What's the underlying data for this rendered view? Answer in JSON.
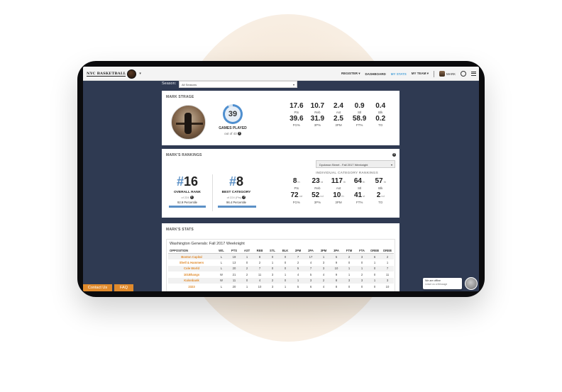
{
  "navbar": {
    "logo_text": "NYC BASKETBALL",
    "caret": "▾",
    "links": [
      {
        "label": "REGISTER ▾",
        "active": false
      },
      {
        "label": "DASHBOARD",
        "active": false
      },
      {
        "label": "MY STATS",
        "active": true
      },
      {
        "label": "MY TEAM ▾",
        "active": false
      }
    ],
    "user_name": "MARK",
    "icons": [
      "user-avatar-icon",
      "power-icon",
      "menu-icon"
    ]
  },
  "season": {
    "label": "Season:",
    "selected": "All Seasons",
    "caret": "▾"
  },
  "profile": {
    "title": "MARK STRAGE",
    "games_played": "39",
    "games_label": "GAMES PLAYED",
    "games_out_of": "out of 43",
    "stats": [
      {
        "value": "17.6",
        "label": "Pts"
      },
      {
        "value": "10.7",
        "label": "Reb"
      },
      {
        "value": "2.4",
        "label": "Ast"
      },
      {
        "value": "0.9",
        "label": "Stl"
      },
      {
        "value": "0.4",
        "label": "Blk"
      },
      {
        "value": "39.6",
        "label": "FG%"
      },
      {
        "value": "31.9",
        "label": "3P%"
      },
      {
        "value": "2.5",
        "label": "3PM"
      },
      {
        "value": "58.9",
        "label": "FT%"
      },
      {
        "value": "0.2",
        "label": "TO"
      }
    ]
  },
  "rankings": {
    "title": "MARK'S RANKINGS",
    "league_select": "Dyckman Street - Fall 2017 Weeknight",
    "overall": {
      "hash": "#",
      "rank": "16",
      "label": "OVERALL RANK",
      "of": "of 224",
      "percentile": "92.9 Percentile",
      "fill": 0.929
    },
    "best": {
      "hash": "#",
      "rank": "8",
      "label": "BEST CATEGORY",
      "of": "of 224 (Pts)",
      "percentile": "96.4 Percentile",
      "fill": 0.964
    },
    "individual_title": "INDIVIDUAL CATEGORY RANKINGS",
    "categories": [
      {
        "value": "8",
        "suffix": "th",
        "label": "Pts"
      },
      {
        "value": "23",
        "suffix": "rd",
        "label": "Reb"
      },
      {
        "value": "117",
        "suffix": "th",
        "label": "Ast"
      },
      {
        "value": "64",
        "suffix": "th",
        "label": "Stl"
      },
      {
        "value": "57",
        "suffix": "th",
        "label": "Blk"
      },
      {
        "value": "72",
        "suffix": "nd",
        "label": "FG%"
      },
      {
        "value": "52",
        "suffix": "nd",
        "label": "3P%"
      },
      {
        "value": "10",
        "suffix": "th",
        "label": "3PM"
      },
      {
        "value": "41",
        "suffix": "st",
        "label": "FT%"
      },
      {
        "value": "2",
        "suffix": "nd",
        "label": "TO"
      }
    ]
  },
  "stats_table": {
    "title": "MARK'S STATS",
    "subtitle": "Washington Generals: Fall 2017 Weeknight",
    "columns": [
      "OPPOSITION",
      "W/L",
      "PTS",
      "AST",
      "REB",
      "STL",
      "BLK",
      "2PM",
      "2PA",
      "3PM",
      "3PA",
      "FTM",
      "FTA",
      "OREB",
      "DREB"
    ],
    "rows": [
      [
        "Boston Capital",
        "L",
        "19",
        "1",
        "8",
        "0",
        "0",
        "7",
        "17",
        "1",
        "5",
        "2",
        "3",
        "6",
        "2"
      ],
      [
        "Shell & Hammers",
        "L",
        "13",
        "0",
        "2",
        "1",
        "0",
        "2",
        "4",
        "3",
        "9",
        "0",
        "0",
        "1",
        "1"
      ],
      [
        "Cole World",
        "L",
        "20",
        "2",
        "7",
        "0",
        "0",
        "5",
        "7",
        "3",
        "10",
        "1",
        "1",
        "0",
        "7"
      ],
      [
        "101Bhangs",
        "W",
        "21",
        "2",
        "11",
        "3",
        "1",
        "4",
        "5",
        "4",
        "9",
        "1",
        "2",
        "0",
        "11"
      ],
      [
        "Kalonbank",
        "W",
        "11",
        "0",
        "4",
        "2",
        "0",
        "1",
        "3",
        "2",
        "8",
        "3",
        "3",
        "1",
        "3"
      ],
      [
        "2323",
        "L",
        "20",
        "1",
        "10",
        "3",
        "1",
        "5",
        "6",
        "4",
        "8",
        "0",
        "0",
        "0",
        "10"
      ]
    ]
  },
  "footer_buttons": {
    "contact": "Contact Us",
    "faq": "FAQ"
  },
  "chat": {
    "line1": "We are offline",
    "line2": "Leave us a Message"
  }
}
